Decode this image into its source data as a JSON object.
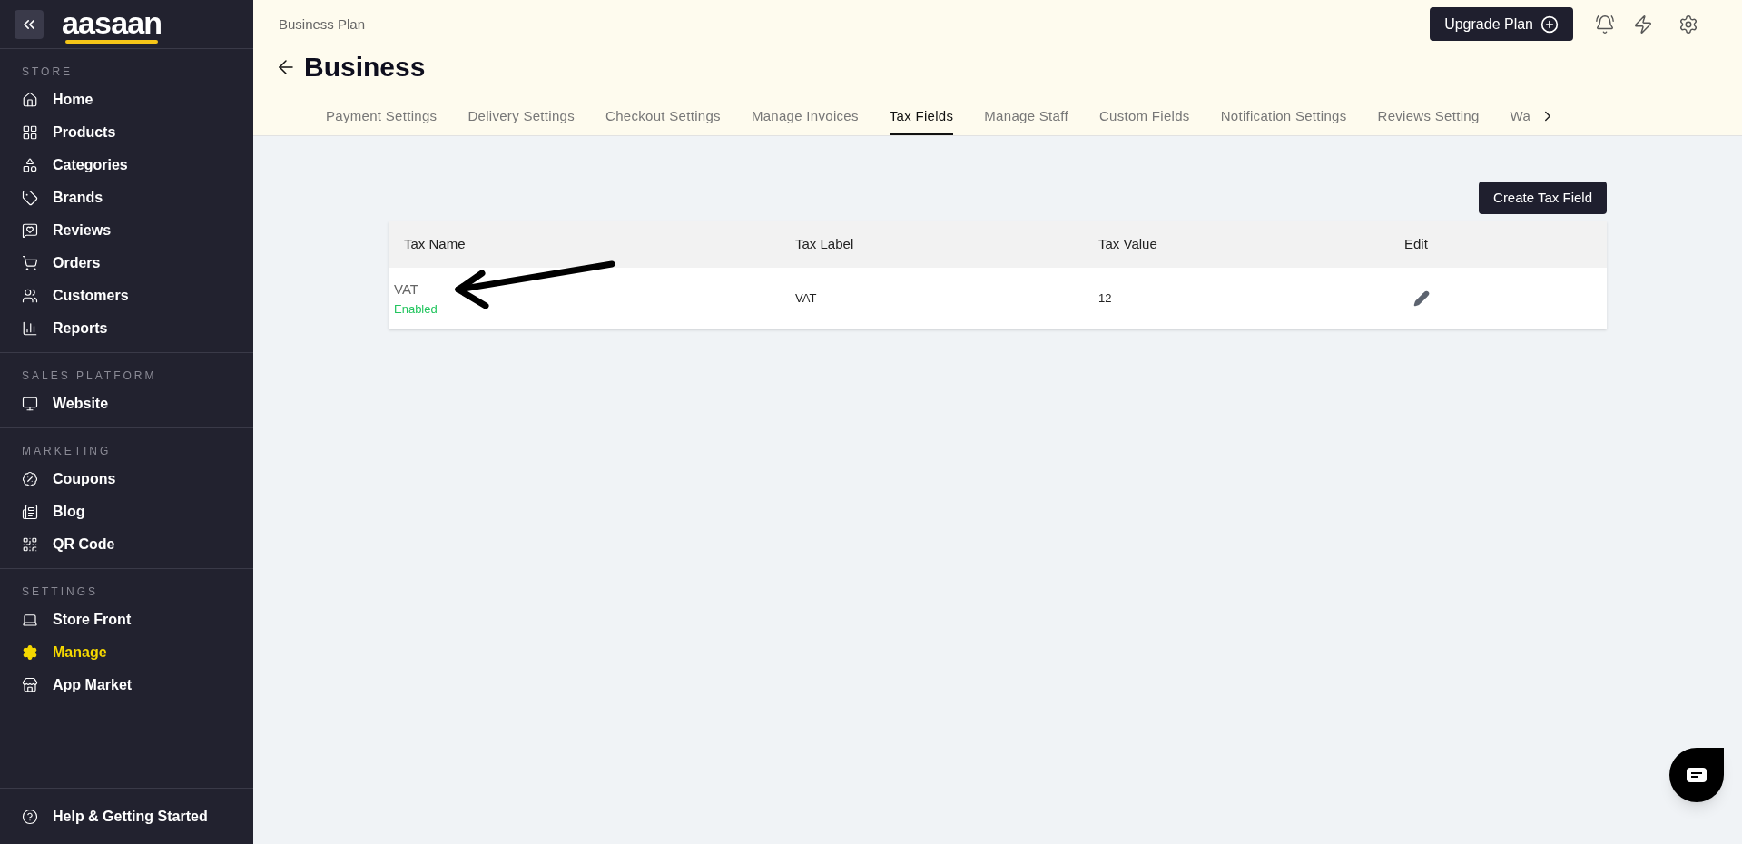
{
  "sidebar": {
    "logo": "aasaan",
    "sections": [
      {
        "title": "STORE",
        "items": [
          {
            "label": "Home",
            "selected": false
          },
          {
            "label": "Products",
            "selected": false
          },
          {
            "label": "Categories",
            "selected": false
          },
          {
            "label": "Brands",
            "selected": false
          },
          {
            "label": "Reviews",
            "selected": false
          },
          {
            "label": "Orders",
            "selected": false
          },
          {
            "label": "Customers",
            "selected": false
          },
          {
            "label": "Reports",
            "selected": false
          }
        ]
      },
      {
        "title": "SALES PLATFORM",
        "items": [
          {
            "label": "Website",
            "selected": false
          }
        ]
      },
      {
        "title": "MARKETING",
        "items": [
          {
            "label": "Coupons",
            "selected": false
          },
          {
            "label": "Blog",
            "selected": false
          },
          {
            "label": "QR Code",
            "selected": false
          }
        ]
      },
      {
        "title": "SETTINGS",
        "items": [
          {
            "label": "Store Front",
            "selected": false
          },
          {
            "label": "Manage",
            "selected": true
          },
          {
            "label": "App Market",
            "selected": false
          }
        ]
      }
    ],
    "help": "Help & Getting Started"
  },
  "header": {
    "plan": "Business Plan",
    "upgrade_button": "Upgrade Plan",
    "title": "Business",
    "tabs": [
      {
        "label": "Payment Settings",
        "selected": false
      },
      {
        "label": "Delivery Settings",
        "selected": false
      },
      {
        "label": "Checkout Settings",
        "selected": false
      },
      {
        "label": "Manage Invoices",
        "selected": false
      },
      {
        "label": "Tax Fields",
        "selected": true
      },
      {
        "label": "Manage Staff",
        "selected": false
      },
      {
        "label": "Custom Fields",
        "selected": false
      },
      {
        "label": "Notification Settings",
        "selected": false
      },
      {
        "label": "Reviews Setting",
        "selected": false
      },
      {
        "label": "Wa",
        "selected": false
      }
    ]
  },
  "create_button": "Create Tax Field",
  "table": {
    "columns": [
      "Tax Name",
      "Tax Label",
      "Tax Value",
      "Edit"
    ],
    "rows": [
      {
        "name": "VAT",
        "status": "Enabled",
        "enabled": true,
        "label": "VAT",
        "value": "12"
      }
    ]
  }
}
